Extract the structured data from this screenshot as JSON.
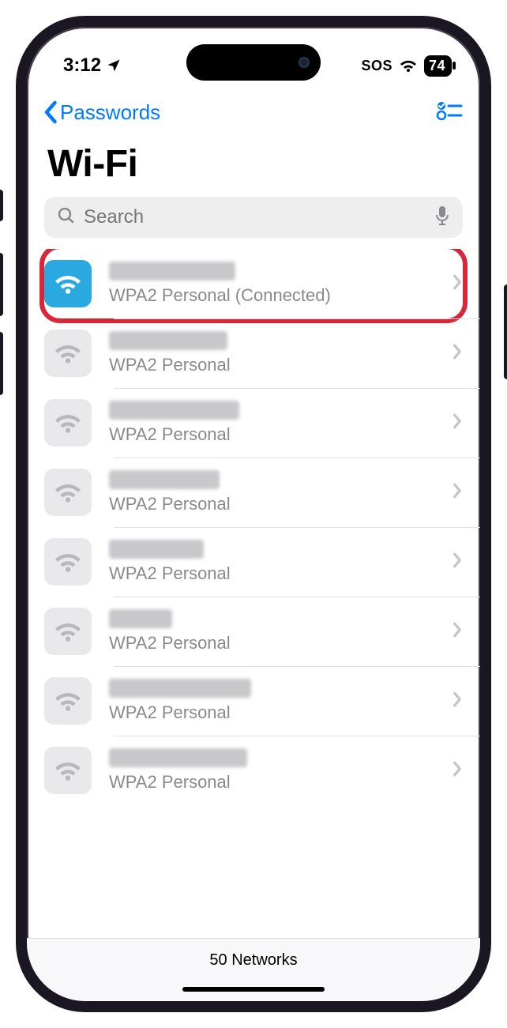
{
  "status": {
    "time": "3:12",
    "sos": "SOS",
    "battery": "74"
  },
  "nav": {
    "back_label": "Passwords"
  },
  "page_title": "Wi-Fi",
  "search": {
    "placeholder": "Search"
  },
  "networks": [
    {
      "security": "WPA2 Personal (Connected)",
      "active": true,
      "blur_w": 160,
      "highlighted": true
    },
    {
      "security": "WPA2 Personal",
      "active": false,
      "blur_w": 150
    },
    {
      "security": "WPA2 Personal",
      "active": false,
      "blur_w": 165
    },
    {
      "security": "WPA2 Personal",
      "active": false,
      "blur_w": 140
    },
    {
      "security": "WPA2 Personal",
      "active": false,
      "blur_w": 120
    },
    {
      "security": "WPA2 Personal",
      "active": false,
      "blur_w": 80
    },
    {
      "security": "WPA2 Personal",
      "active": false,
      "blur_w": 180
    },
    {
      "security": "WPA2 Personal",
      "active": false,
      "blur_w": 175
    }
  ],
  "footer": {
    "count_label": "50 Networks"
  },
  "colors": {
    "accent": "#007aff",
    "active_icon_bg": "#2aa8e0",
    "highlight": "#d92638"
  }
}
